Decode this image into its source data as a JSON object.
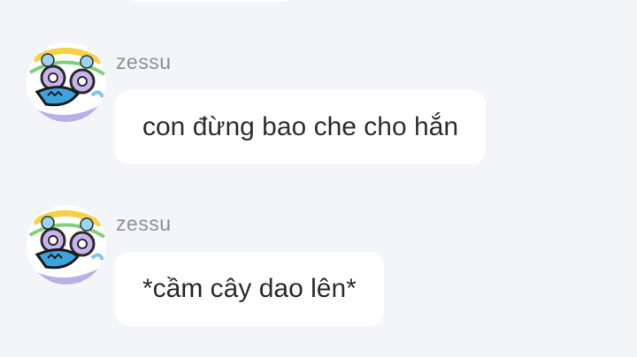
{
  "messages": [
    {
      "username": "zessu",
      "text": "con đừng bao che cho hắn",
      "avatar_icon": "cartoon-face-avatar-icon"
    },
    {
      "username": "zessu",
      "text": "*cầm cây dao lên*",
      "avatar_icon": "cartoon-face-avatar-icon"
    }
  ],
  "colors": {
    "background": "#f4f5f8",
    "bubble": "#ffffff",
    "username": "#8e9197",
    "message_text": "#2c2d30"
  }
}
